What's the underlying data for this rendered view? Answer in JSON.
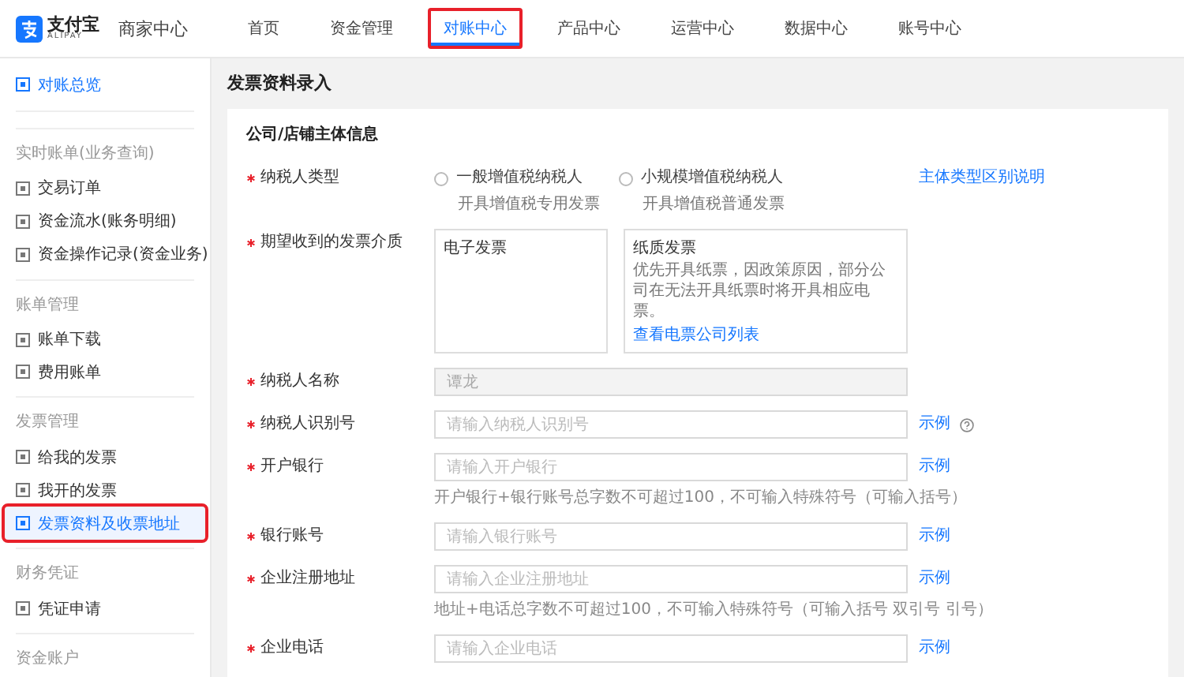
{
  "header": {
    "logo_text": "支付宝",
    "logo_sub": "ALIPAY",
    "product": "商家中心",
    "nav": [
      {
        "label": "首页",
        "selected": false,
        "highlighted": false
      },
      {
        "label": "资金管理",
        "selected": false,
        "highlighted": false
      },
      {
        "label": "对账中心",
        "selected": true,
        "highlighted": true
      },
      {
        "label": "产品中心",
        "selected": false,
        "highlighted": false
      },
      {
        "label": "运营中心",
        "selected": false,
        "highlighted": false
      },
      {
        "label": "数据中心",
        "selected": false,
        "highlighted": false
      },
      {
        "label": "账号中心",
        "selected": false,
        "highlighted": false
      }
    ]
  },
  "sidebar": {
    "items": [
      {
        "kind": "overview",
        "label": "对账总览",
        "selected": false,
        "highlighted": false
      },
      {
        "kind": "header",
        "label": "实时账单(业务查询)"
      },
      {
        "kind": "item",
        "label": "交易订单",
        "selected": false,
        "highlighted": false
      },
      {
        "kind": "item",
        "label": "资金流水(账务明细)",
        "selected": false,
        "highlighted": false
      },
      {
        "kind": "item",
        "label": "资金操作记录(资金业务)",
        "selected": false,
        "highlighted": false
      },
      {
        "kind": "header",
        "label": "账单管理"
      },
      {
        "kind": "item",
        "label": "账单下载",
        "selected": false,
        "highlighted": false
      },
      {
        "kind": "item",
        "label": "费用账单",
        "selected": false,
        "highlighted": false
      },
      {
        "kind": "header",
        "label": "发票管理"
      },
      {
        "kind": "item",
        "label": "给我的发票",
        "selected": false,
        "highlighted": false
      },
      {
        "kind": "item",
        "label": "我开的发票",
        "selected": false,
        "highlighted": false
      },
      {
        "kind": "item",
        "label": "发票资料及收票地址",
        "selected": true,
        "highlighted": true
      },
      {
        "kind": "header",
        "label": "财务凭证"
      },
      {
        "kind": "item",
        "label": "凭证申请",
        "selected": false,
        "highlighted": false
      },
      {
        "kind": "header",
        "label": "资金账户"
      }
    ]
  },
  "page_title": "发票资料录入",
  "form": {
    "section_title": "公司/店铺主体信息",
    "fields": [
      {
        "kind": "radio",
        "label": "纳税人类型",
        "required": true,
        "link": "主体类型区别说明",
        "options": [
          {
            "label": "一般增值税纳税人",
            "note": "开具增值税专用发票",
            "selected": false
          },
          {
            "label": "小规模增值税纳税人",
            "note": "开具增值税普通发票",
            "selected": false
          }
        ]
      },
      {
        "kind": "medium",
        "label": "期望收到的发票介质",
        "required": true,
        "options": [
          {
            "title": "电子发票",
            "selected": false
          },
          {
            "title": "纸质发票",
            "description": "优先开具纸票，因政策原因，部分公司在无法开具纸票时将开具相应电票。",
            "link": "查看电票公司列表",
            "selected": false
          }
        ]
      },
      {
        "kind": "input",
        "label": "纳税人名称",
        "required": true,
        "value": "谭龙",
        "disabled": true
      },
      {
        "kind": "input",
        "label": "纳税人识别号",
        "required": true,
        "placeholder": "请输入纳税人识别号",
        "disabled": false,
        "link": "示例",
        "help": true
      },
      {
        "kind": "input",
        "label": "开户银行",
        "required": true,
        "placeholder": "请输入开户银行",
        "disabled": false,
        "link": "示例",
        "hint": "开户银行+银行账号总字数不可超过100，不可输入特殊符号（可输入括号）"
      },
      {
        "kind": "input",
        "label": "银行账号",
        "required": true,
        "placeholder": "请输入银行账号",
        "disabled": false,
        "link": "示例"
      },
      {
        "kind": "input",
        "label": "企业注册地址",
        "required": true,
        "placeholder": "请输入企业注册地址",
        "disabled": false,
        "link": "示例",
        "hint": "地址+电话总字数不可超过100，不可输入特殊符号（可输入括号 双引号 引号）"
      },
      {
        "kind": "input",
        "label": "企业电话",
        "required": true,
        "placeholder": "请输入企业电话",
        "disabled": false,
        "link": "示例"
      }
    ]
  }
}
